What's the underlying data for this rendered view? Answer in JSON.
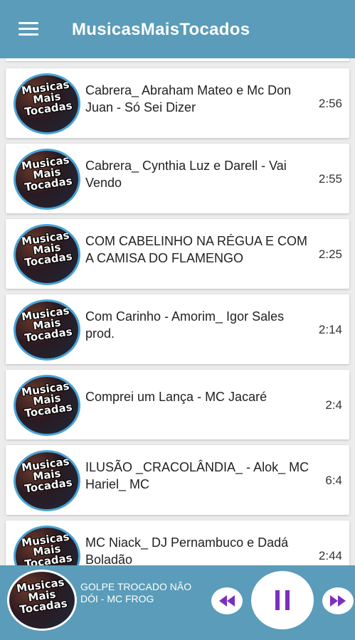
{
  "app": {
    "title": "MusicasMaisTocados"
  },
  "thumb": {
    "line1": "Musicas",
    "line2": "Mais",
    "line3": "Tocadas"
  },
  "songs": [
    {
      "title": "Cabrera_ Abraham Mateo e Mc Don Juan - Só Sei Dizer",
      "duration": "2:56"
    },
    {
      "title": "Cabrera_ Cynthia Luz e Darell - Vai Vendo",
      "duration": "2:55"
    },
    {
      "title": "COM CABELINHO NA RÉGUA E COM A CAMISA DO FLAMENGO",
      "duration": "2:25"
    },
    {
      "title": "Com Carinho - Amorim_ Igor Sales  prod.",
      "duration": "2:14"
    },
    {
      "title": "Comprei um Lança - MC Jacaré",
      "duration": "2:4"
    },
    {
      "title": "ILUSÃO _CRACOLÂNDIA_ - Alok_ MC Hariel_ MC",
      "duration": "6:4"
    },
    {
      "title": "MC Niack_ DJ Pernambuco e Dadá Boladão",
      "duration": "2:44"
    }
  ],
  "player": {
    "now_playing": "GOLPE TROCADO NÃO DÓI - MC FROG",
    "accent_color": "#7b2fbe"
  }
}
